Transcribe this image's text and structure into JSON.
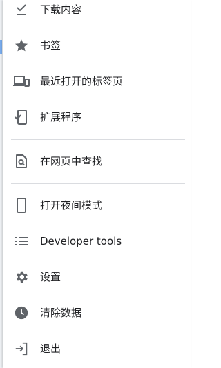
{
  "menu": {
    "items": [
      {
        "label": "下载内容",
        "icon": "download-check-icon"
      },
      {
        "label": "书签",
        "icon": "star-icon"
      },
      {
        "label": "最近打开的标签页",
        "icon": "devices-icon"
      },
      {
        "label": "扩展程序",
        "icon": "extension-icon"
      },
      {
        "label": "在网页中查找",
        "icon": "find-in-page-icon"
      },
      {
        "label": "打开夜间模式",
        "icon": "phone-icon"
      },
      {
        "label": "Developer tools",
        "icon": "list-icon"
      },
      {
        "label": "设置",
        "icon": "gear-icon"
      },
      {
        "label": "清除数据",
        "icon": "clock-icon"
      },
      {
        "label": "退出",
        "icon": "exit-icon"
      }
    ]
  },
  "colors": {
    "icon": "#5f6368",
    "text": "#202124",
    "divider": "#dadce0"
  }
}
